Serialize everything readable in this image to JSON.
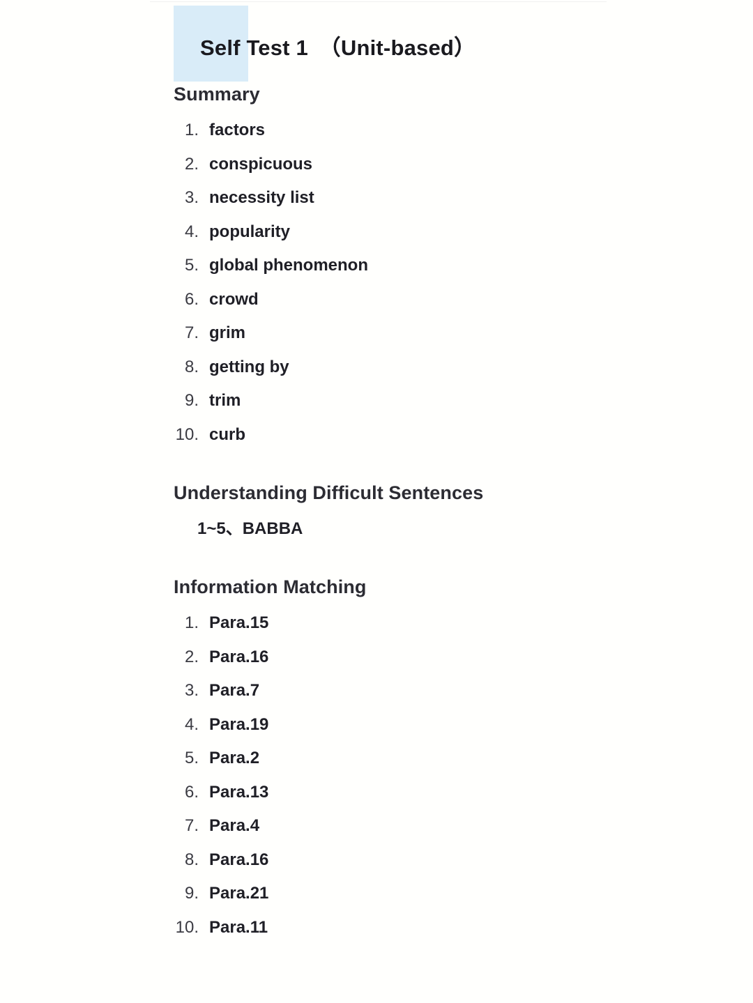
{
  "document": {
    "title": "Self Test 1　（Unit-based）",
    "title_highlight_color": "#d9ecf8",
    "background_color": "#fffffd",
    "text_color": "#2c2c33"
  },
  "sections": [
    {
      "id": "summary",
      "heading": "Summary",
      "type": "numbered-list",
      "items": [
        {
          "num": "1.",
          "text": "factors"
        },
        {
          "num": "2.",
          "text": "conspicuous"
        },
        {
          "num": "3.",
          "text": "necessity list"
        },
        {
          "num": "4.",
          "text": "popularity"
        },
        {
          "num": "5.",
          "text": "global phenomenon"
        },
        {
          "num": "6.",
          "text": "crowd"
        },
        {
          "num": "7.",
          "text": "grim"
        },
        {
          "num": "8.",
          "text": "getting by"
        },
        {
          "num": "9.",
          "text": "trim"
        },
        {
          "num": "10.",
          "text": "curb"
        }
      ]
    },
    {
      "id": "understanding-difficult-sentences",
      "heading": "Understanding Difficult Sentences",
      "type": "plain-answer",
      "answer": "1~5、BABBA"
    },
    {
      "id": "information-matching",
      "heading": "Information Matching",
      "type": "numbered-list",
      "items": [
        {
          "num": "1.",
          "text": "Para.15"
        },
        {
          "num": "2.",
          "text": "Para.16"
        },
        {
          "num": "3.",
          "text": "Para.7"
        },
        {
          "num": "4.",
          "text": "Para.19"
        },
        {
          "num": "5.",
          "text": "Para.2"
        },
        {
          "num": "6.",
          "text": "Para.13"
        },
        {
          "num": "7.",
          "text": "Para.4"
        },
        {
          "num": "8.",
          "text": "Para.16"
        },
        {
          "num": "9.",
          "text": "Para.21"
        },
        {
          "num": "10.",
          "text": "Para.11"
        }
      ]
    }
  ]
}
